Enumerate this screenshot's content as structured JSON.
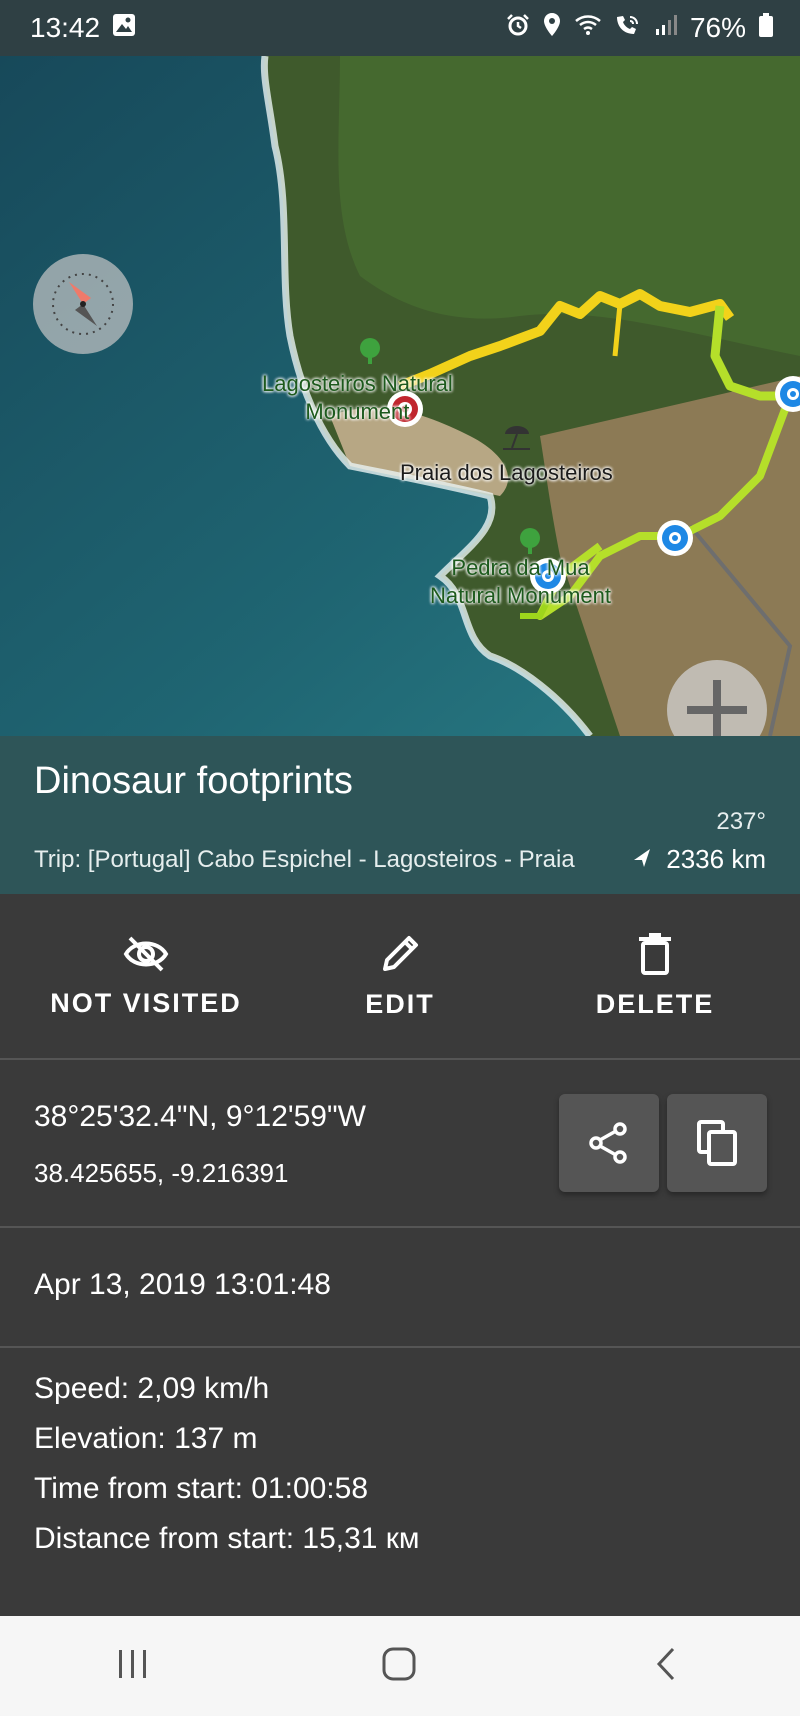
{
  "status": {
    "time": "13:42",
    "battery": "76%"
  },
  "map": {
    "labels": {
      "lagosteiros_line1": "Lagosteiros Natural",
      "lagosteiros_line2": "Monument",
      "praia": "Praia dos Lagosteiros",
      "pedra_line1": "Pedra da Mua",
      "pedra_line2": "Natural Monument"
    }
  },
  "point": {
    "title": "Dinosaur footprints",
    "bearing": "237°",
    "trip": "Trip: [Portugal] Cabo Espichel - Lagosteiros - Praia",
    "distance": "2336 km"
  },
  "actions": {
    "not_visited": "NOT VISITED",
    "edit": "EDIT",
    "delete": "DELETE"
  },
  "coords": {
    "dms": "38°25'32.4\"N, 9°12'59\"W",
    "decimal": "38.425655, -9.216391"
  },
  "datetime": "Apr 13, 2019 13:01:48",
  "stats": {
    "speed": "Speed: 2,09 km/h",
    "elevation": "Elevation: 137 m",
    "time_from_start": "Time from start: 01:00:58",
    "distance_from_start": "Distance from start: 15,31 км"
  },
  "colors": {
    "header": "#2e5558",
    "panel": "#3a3a3a",
    "track_yellow": "#f2d21a",
    "track_green": "#b5df2a",
    "start_marker": "#c0262e",
    "waypoint": "#1e88e5"
  }
}
